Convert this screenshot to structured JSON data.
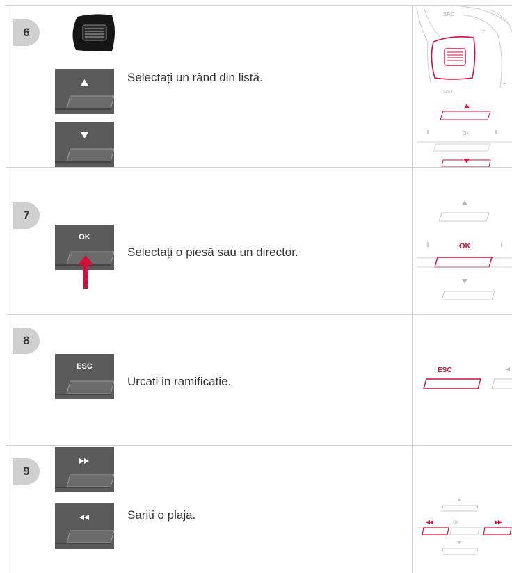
{
  "rows": [
    {
      "number": "6",
      "text": "Selectați un rând din listă.",
      "button_icons": [
        "up-arrow-icon",
        "down-arrow-icon"
      ]
    },
    {
      "number": "7",
      "text": "Selectați o piesă sau un director.",
      "button_label": "OK"
    },
    {
      "number": "8",
      "text": "Urcati in ramificatie.",
      "button_label": "ESC"
    },
    {
      "number": "9",
      "text": "Sariti o plaja.",
      "button_icons": [
        "fast-forward-icon",
        "rewind-icon"
      ]
    }
  ],
  "diagram_labels": {
    "src": "SRC",
    "plus": "+",
    "minus": "-",
    "list": "LIST",
    "ok": "OK",
    "esc": "ESC"
  },
  "colors": {
    "highlight": "#d0103a",
    "button_dark": "#5a5a5a",
    "number_badge": "#cfcfcf",
    "grid_line": "#cfcfcf"
  }
}
